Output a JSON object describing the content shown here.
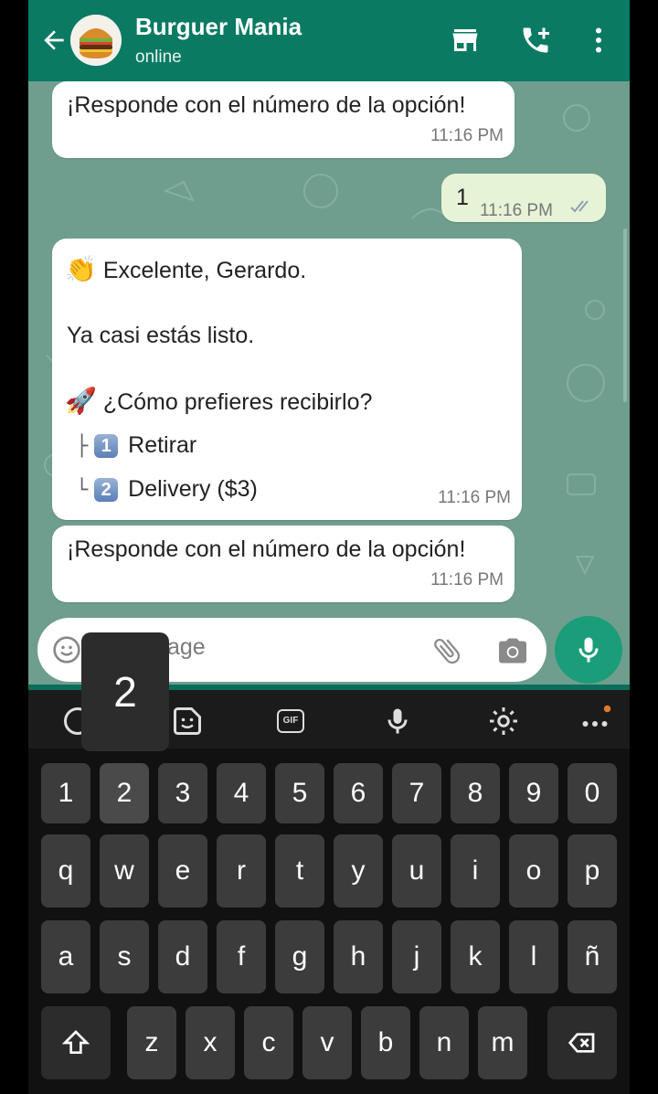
{
  "header": {
    "contact_name": "Burguer Mania",
    "status": "online",
    "icons": [
      "back-arrow-icon",
      "store-icon",
      "add-call-icon",
      "more-vert-icon"
    ]
  },
  "messages": [
    {
      "direction": "in",
      "text": "¡Responde con el número de la opción!",
      "time": "11:16 PM"
    },
    {
      "direction": "out",
      "text": "1",
      "time": "11:16 PM",
      "status": "read"
    },
    {
      "direction": "in",
      "greeting": "Excelente, Gerardo.",
      "line2": "Ya casi estás listo.",
      "question": "¿Cómo prefieres recibirlo?",
      "options": [
        {
          "num": "1",
          "label": "Retirar"
        },
        {
          "num": "2",
          "label": "Delivery ($3)"
        }
      ],
      "time": "11:16 PM"
    },
    {
      "direction": "in",
      "text": "¡Responde con el número de la opción!",
      "time": "11:16 PM"
    }
  ],
  "composer": {
    "placeholder_visible": "age",
    "key_preview": "2"
  },
  "keyboard": {
    "row_numbers": [
      "1",
      "2",
      "3",
      "4",
      "5",
      "6",
      "7",
      "8",
      "9",
      "0"
    ],
    "row1": [
      "q",
      "w",
      "e",
      "r",
      "t",
      "y",
      "u",
      "i",
      "o",
      "p"
    ],
    "row2": [
      "a",
      "s",
      "d",
      "f",
      "g",
      "h",
      "j",
      "k",
      "l",
      "ñ"
    ],
    "row3": [
      "z",
      "x",
      "c",
      "v",
      "b",
      "n",
      "m"
    ],
    "tools": [
      "emoji-icon",
      "sticker-icon",
      "gif-icon",
      "voice-icon",
      "settings-icon",
      "more-icon"
    ],
    "gif_label": "GIF"
  },
  "colors": {
    "header": "#0a7a63",
    "accent": "#1a9d78",
    "outgoing_bubble": "#e7f3d6",
    "read_ticks": "#53bdeb"
  }
}
